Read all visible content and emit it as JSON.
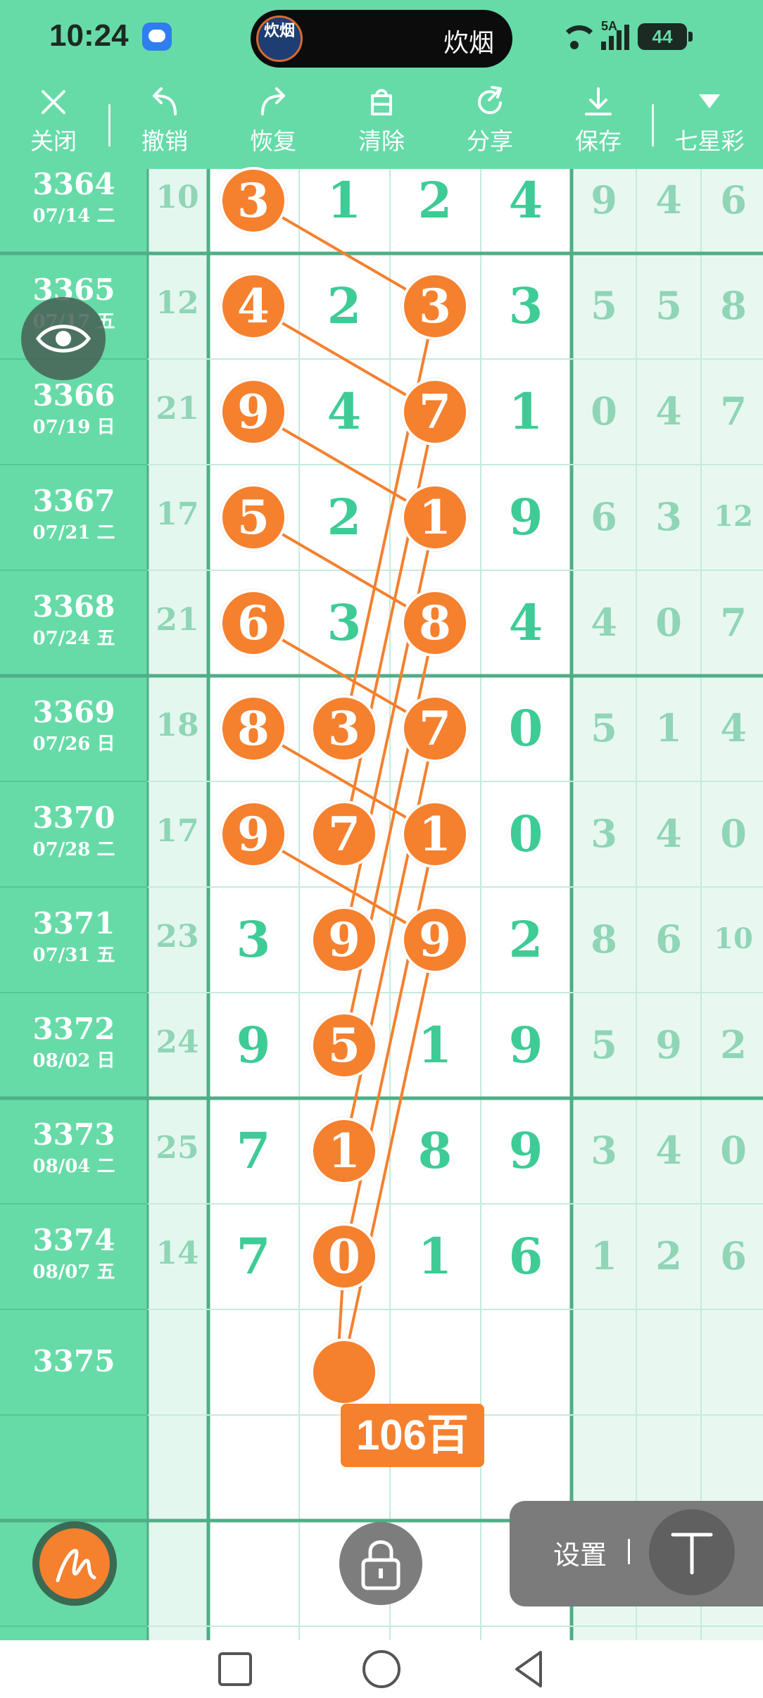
{
  "status_bar": {
    "time": "10:24",
    "app_pill_title": "炊烟",
    "app_pill_icon_text": "炊烟",
    "network": "5A",
    "battery": "44"
  },
  "toolbar": {
    "close": "关闭",
    "undo": "撤销",
    "redo": "恢复",
    "clear": "清除",
    "share": "分享",
    "save": "保存",
    "game": "七星彩"
  },
  "rows": [
    {
      "issue": "3364",
      "date": "07/14 二",
      "sum": "10",
      "d1": "3",
      "d2": "1",
      "d3": "2",
      "d4": "4",
      "e1": "9",
      "e2": "4",
      "e3": "6"
    },
    {
      "issue": "3365",
      "date": "07/17 五",
      "sum": "12",
      "d1": "4",
      "d2": "2",
      "d3": "3",
      "d4": "3",
      "e1": "5",
      "e2": "5",
      "e3": "8"
    },
    {
      "issue": "3366",
      "date": "07/19 日",
      "sum": "21",
      "d1": "9",
      "d2": "4",
      "d3": "7",
      "d4": "1",
      "e1": "0",
      "e2": "4",
      "e3": "7"
    },
    {
      "issue": "3367",
      "date": "07/21 二",
      "sum": "17",
      "d1": "5",
      "d2": "2",
      "d3": "1",
      "d4": "9",
      "e1": "6",
      "e2": "3",
      "e3": "12"
    },
    {
      "issue": "3368",
      "date": "07/24 五",
      "sum": "21",
      "d1": "6",
      "d2": "3",
      "d3": "8",
      "d4": "4",
      "e1": "4",
      "e2": "0",
      "e3": "7"
    },
    {
      "issue": "3369",
      "date": "07/26 日",
      "sum": "18",
      "d1": "8",
      "d2": "3",
      "d3": "7",
      "d4": "0",
      "e1": "5",
      "e2": "1",
      "e3": "4"
    },
    {
      "issue": "3370",
      "date": "07/28 二",
      "sum": "17",
      "d1": "9",
      "d2": "7",
      "d3": "1",
      "d4": "0",
      "e1": "3",
      "e2": "4",
      "e3": "0"
    },
    {
      "issue": "3371",
      "date": "07/31 五",
      "sum": "23",
      "d1": "3",
      "d2": "9",
      "d3": "9",
      "d4": "2",
      "e1": "8",
      "e2": "6",
      "e3": "10"
    },
    {
      "issue": "3372",
      "date": "08/02 日",
      "sum": "24",
      "d1": "9",
      "d2": "5",
      "d3": "1",
      "d4": "9",
      "e1": "5",
      "e2": "9",
      "e3": "2"
    },
    {
      "issue": "3373",
      "date": "08/04 二",
      "sum": "25",
      "d1": "7",
      "d2": "1",
      "d3": "8",
      "d4": "9",
      "e1": "3",
      "e2": "4",
      "e3": "0"
    },
    {
      "issue": "3374",
      "date": "08/07 五",
      "sum": "14",
      "d1": "7",
      "d2": "0",
      "d3": "1",
      "d4": "6",
      "e1": "1",
      "e2": "2",
      "e3": "6"
    },
    {
      "issue": "3375",
      "date": "",
      "sum": "",
      "d1": "",
      "d2": "",
      "d3": "",
      "d4": "",
      "e1": "",
      "e2": "",
      "e3": ""
    }
  ],
  "highlights": [
    {
      "row": 0,
      "col": 1
    },
    {
      "row": 1,
      "col": 1
    },
    {
      "row": 1,
      "col": 3
    },
    {
      "row": 2,
      "col": 1
    },
    {
      "row": 2,
      "col": 3
    },
    {
      "row": 3,
      "col": 1
    },
    {
      "row": 3,
      "col": 3
    },
    {
      "row": 4,
      "col": 1
    },
    {
      "row": 4,
      "col": 3
    },
    {
      "row": 5,
      "col": 1
    },
    {
      "row": 5,
      "col": 2
    },
    {
      "row": 5,
      "col": 3
    },
    {
      "row": 6,
      "col": 1
    },
    {
      "row": 6,
      "col": 2
    },
    {
      "row": 6,
      "col": 3
    },
    {
      "row": 7,
      "col": 2
    },
    {
      "row": 7,
      "col": 3
    },
    {
      "row": 8,
      "col": 2
    },
    {
      "row": 9,
      "col": 2
    },
    {
      "row": 10,
      "col": 2
    }
  ],
  "pending_marker_badge": "106百",
  "settings_panel": {
    "label": "设置",
    "button_glyph": "T"
  },
  "colors": {
    "mint": "#66dba8",
    "orange": "#f5802e",
    "digit_green": "#3ecb96",
    "pale_digit": "#8fd5b6"
  }
}
